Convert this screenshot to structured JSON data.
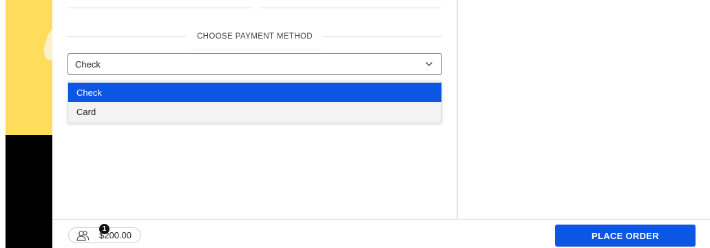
{
  "payment": {
    "section_title": "CHOOSE PAYMENT METHOD",
    "selected_value": "Check",
    "options": [
      {
        "label": "Check",
        "selected": true
      },
      {
        "label": "Card",
        "selected": false
      }
    ]
  },
  "bottom_bar": {
    "cart_count": "1",
    "cart_total": "$200.00",
    "place_order_label": "PLACE ORDER"
  },
  "colors": {
    "accent": "#0b57e3",
    "strip_yellow": "#ffdc5c",
    "strip_black": "#000000"
  },
  "icons": {
    "select_chevron": "chevron-down-icon",
    "cart": "users-icon"
  }
}
